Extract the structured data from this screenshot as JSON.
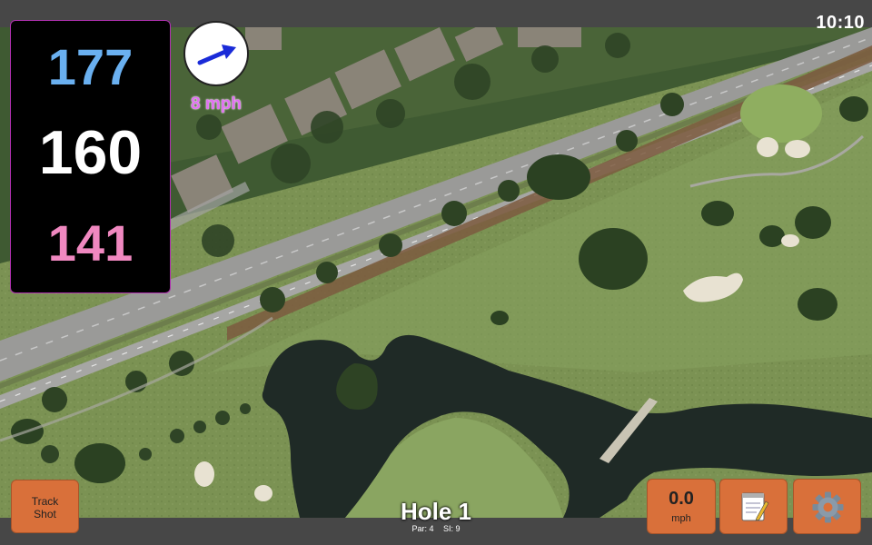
{
  "status_bar": {
    "time": "10:10"
  },
  "distances": {
    "back": "177",
    "middle": "160",
    "front": "141",
    "colors": {
      "back": "#6ab0f0",
      "middle": "#ffffff",
      "front": "#f088c0"
    }
  },
  "wind": {
    "speed": "8 mph",
    "direction_icon": "arrow-right-up-icon"
  },
  "hole": {
    "title": "Hole 1",
    "par": "Par: 4",
    "si": "SI: 9"
  },
  "buttons": {
    "track_line1": "Track",
    "track_line2": "Shot",
    "speed_value": "0.0",
    "speed_unit": "mph",
    "notes_icon": "notepad-icon",
    "settings_icon": "gear-icon"
  },
  "colors": {
    "accent": "#d9703a",
    "panel": "#000000",
    "wind_text": "#e070f0"
  }
}
